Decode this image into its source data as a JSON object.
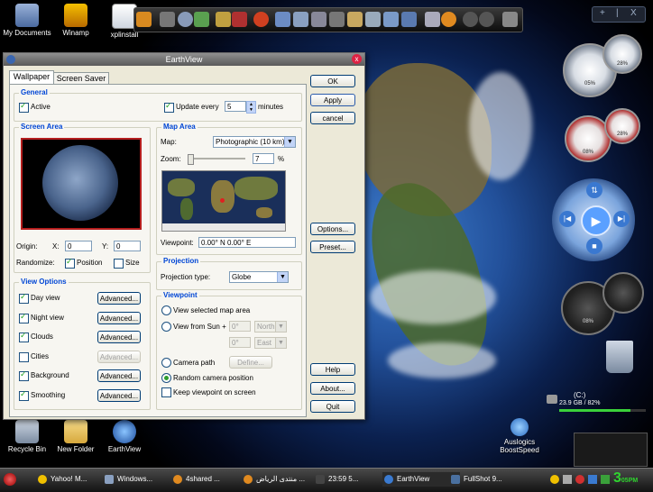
{
  "desktop": {
    "icons_top": [
      {
        "label": "My Documents"
      },
      {
        "label": "Winamp"
      },
      {
        "label": "xplinstall"
      }
    ],
    "icons_bottom": [
      {
        "label": "Recycle Bin"
      },
      {
        "label": "New Folder"
      },
      {
        "label": "EarthView"
      }
    ],
    "auslogics": {
      "line1": "Auslogics",
      "line2": "BoostSpeed"
    },
    "drive": {
      "name": "(C:)",
      "info": "23.9 GB / 82%"
    },
    "gauges": [
      {
        "value": "05%"
      },
      {
        "value": "28%"
      },
      {
        "value": "08%"
      },
      {
        "value": "28%"
      },
      {
        "value": "08%"
      }
    ],
    "top_right_buttons": [
      "+",
      "|",
      "X"
    ]
  },
  "window": {
    "title": "EarthView",
    "close_glyph": "x",
    "tabs": [
      {
        "label": "Wallpaper",
        "active": true
      },
      {
        "label": "Screen Saver",
        "active": false
      }
    ],
    "general": {
      "caption": "General",
      "active_label": "Active",
      "active_checked": true,
      "update_label": "Update every",
      "update_checked": true,
      "update_value": "5",
      "update_unit": "minutes"
    },
    "screen_area": {
      "caption": "Screen Area",
      "origin_label": "Origin:",
      "x_label": "X:",
      "x_value": "0",
      "y_label": "Y:",
      "y_value": "0",
      "randomize_label": "Randomize:",
      "position_label": "Position",
      "position_checked": true,
      "size_label": "Size",
      "size_checked": false
    },
    "map_area": {
      "caption": "Map Area",
      "map_label": "Map:",
      "map_value": "Photographic (10 km)",
      "zoom_label": "Zoom:",
      "zoom_value": "7",
      "zoom_unit": "%",
      "viewpoint_label": "Viewpoint:",
      "viewpoint_value": "0.00° N  0.00° E"
    },
    "view_options": {
      "caption": "View Options",
      "items": [
        {
          "label": "Day view",
          "checked": true,
          "button": "Advanced...",
          "enabled": true
        },
        {
          "label": "Night view",
          "checked": true,
          "button": "Advanced...",
          "enabled": true
        },
        {
          "label": "Clouds",
          "checked": true,
          "button": "Advanced...",
          "enabled": true
        },
        {
          "label": "Cities",
          "checked": false,
          "button": "Advanced...",
          "enabled": false
        },
        {
          "label": "Background",
          "checked": true,
          "button": "Advanced...",
          "enabled": true
        },
        {
          "label": "Smoothing",
          "checked": true,
          "button": "Advanced...",
          "enabled": true
        }
      ]
    },
    "projection": {
      "caption": "Projection",
      "type_label": "Projection type:",
      "type_value": "Globe"
    },
    "viewpoint": {
      "caption": "Viewpoint",
      "view_selected": "View selected map area",
      "view_from_sun": "View from Sun +",
      "sun_lat": "0°",
      "sun_lat_dir": "North",
      "sun_lon": "0°",
      "sun_lon_dir": "East",
      "camera_path": "Camera path",
      "define_button": "Define...",
      "random_camera": "Random camera position",
      "keep_viewpoint": "Keep viewpoint on screen",
      "selected_option": "random_camera"
    },
    "buttons": {
      "ok": "OK",
      "apply": "Apply",
      "cancel": "cancel",
      "options": "Options...",
      "preset": "Preset...",
      "help": "Help",
      "about": "About...",
      "quit": "Quit"
    }
  },
  "taskbar": {
    "items": [
      {
        "label": "Yahoo! M..."
      },
      {
        "label": "Windows..."
      },
      {
        "label": "4shared ..."
      },
      {
        "label": "منتدى الرياض ..."
      },
      {
        "label": "23:59 5..."
      },
      {
        "label": "EarthView"
      },
      {
        "label": "FullShot 9..."
      }
    ],
    "clock_time": "3",
    "clock_min": "05",
    "clock_ampm": "PM"
  }
}
